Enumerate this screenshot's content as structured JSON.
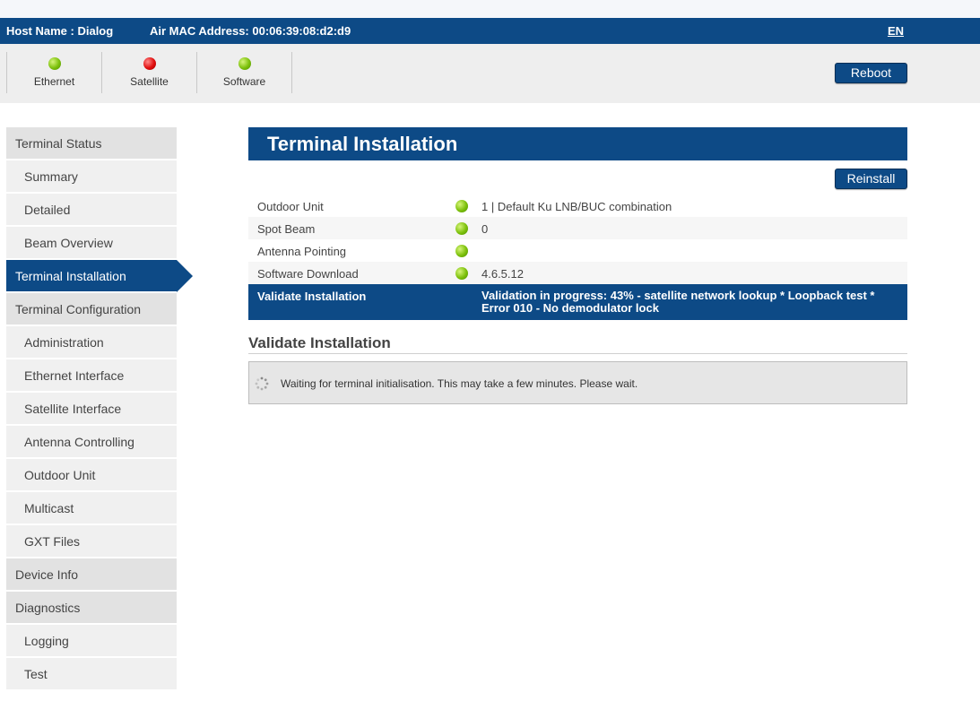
{
  "header": {
    "host_name": "Host Name : Dialog",
    "mac": "Air MAC Address:  00:06:39:08:d2:d9",
    "language": "EN"
  },
  "indicators": [
    {
      "label": "Ethernet",
      "status": "green"
    },
    {
      "label": "Satellite",
      "status": "red"
    },
    {
      "label": "Software",
      "status": "green"
    }
  ],
  "reboot_label": "Reboot",
  "sidebar": {
    "items": [
      {
        "label": "Terminal Status"
      },
      {
        "label": "Summary"
      },
      {
        "label": "Detailed"
      },
      {
        "label": "Beam Overview"
      },
      {
        "label": "Terminal Installation"
      },
      {
        "label": "Terminal Configuration"
      },
      {
        "label": "Administration"
      },
      {
        "label": "Ethernet Interface"
      },
      {
        "label": "Satellite Interface"
      },
      {
        "label": "Antenna Controlling"
      },
      {
        "label": "Outdoor Unit"
      },
      {
        "label": "Multicast"
      },
      {
        "label": "GXT Files"
      },
      {
        "label": "Device Info"
      },
      {
        "label": "Diagnostics"
      },
      {
        "label": "Logging"
      },
      {
        "label": "Test"
      }
    ]
  },
  "main": {
    "title": "Terminal Installation",
    "reinstall_label": "Reinstall",
    "rows": [
      {
        "label": "Outdoor Unit",
        "status": "green",
        "value": "1 | Default Ku LNB/BUC combination"
      },
      {
        "label": "Spot Beam",
        "status": "green",
        "value": "0"
      },
      {
        "label": "Antenna Pointing",
        "status": "green",
        "value": ""
      },
      {
        "label": "Software Download",
        "status": "green",
        "value": "4.6.5.12"
      }
    ],
    "validate_row": {
      "label": "Validate Installation",
      "value": "Validation in progress: 43% - satellite network lookup * Loopback test * Error 010 - No demodulator lock"
    },
    "section_title": "Validate Installation",
    "notice": "Waiting for terminal initialisation. This may take a few minutes. Please wait."
  },
  "colors": {
    "brand": "#0d4a86",
    "ok": "#7cc00b",
    "error": "#e00d0d"
  }
}
